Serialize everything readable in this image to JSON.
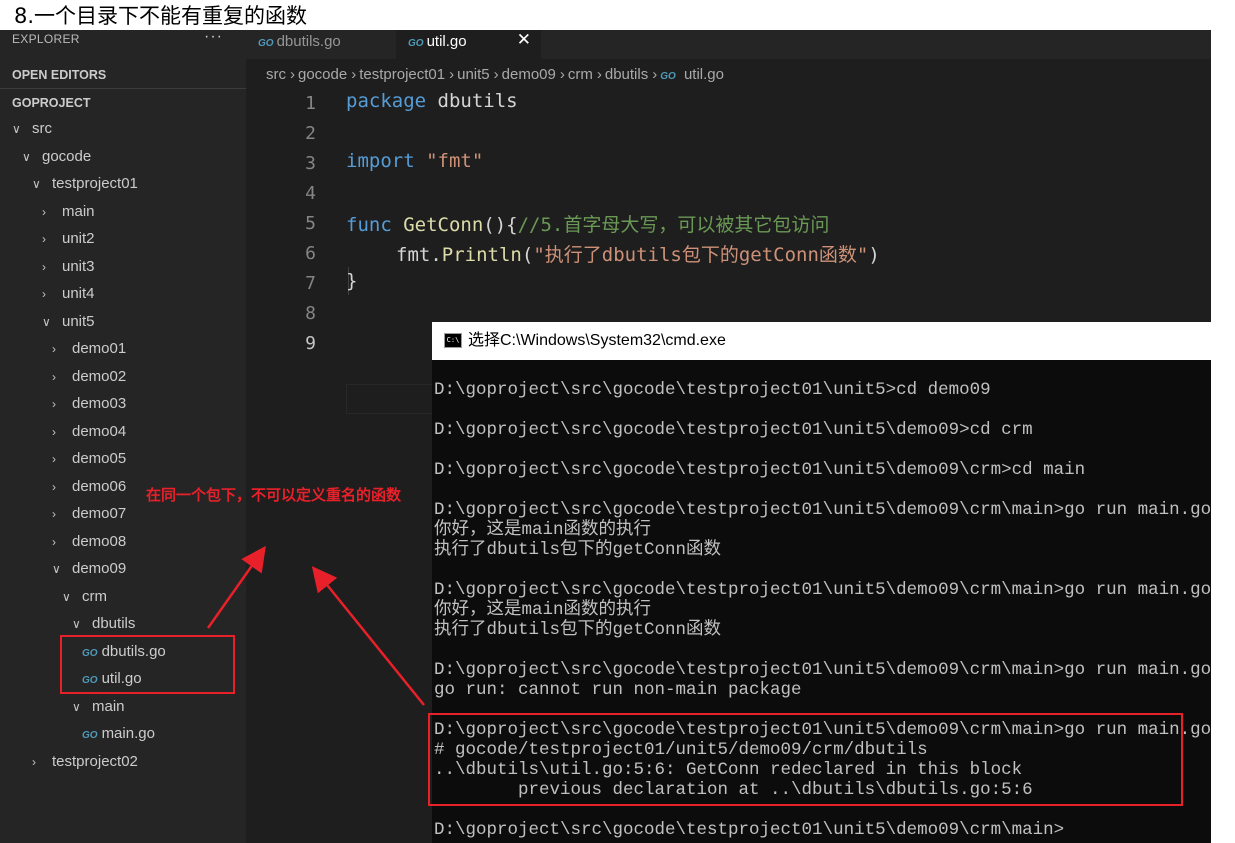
{
  "heading": "8.一个目录下不能有重复的函数",
  "sidebar": {
    "header": "EXPLORER",
    "more": "···",
    "open_editors": "OPEN EDITORS",
    "project": "GOPROJECT",
    "tree": [
      {
        "label": "src",
        "chevron": "∨"
      },
      {
        "label": "gocode",
        "chevron": "∨"
      },
      {
        "label": "testproject01",
        "chevron": "∨"
      },
      {
        "label": "main",
        "chevron": "›"
      },
      {
        "label": "unit2",
        "chevron": "›"
      },
      {
        "label": "unit3",
        "chevron": "›"
      },
      {
        "label": "unit4",
        "chevron": "›"
      },
      {
        "label": "unit5",
        "chevron": "∨"
      },
      {
        "label": "demo01",
        "chevron": "›"
      },
      {
        "label": "demo02",
        "chevron": "›"
      },
      {
        "label": "demo03",
        "chevron": "›"
      },
      {
        "label": "demo04",
        "chevron": "›"
      },
      {
        "label": "demo05",
        "chevron": "›"
      },
      {
        "label": "demo06",
        "chevron": "›"
      },
      {
        "label": "demo07",
        "chevron": "›"
      },
      {
        "label": "demo08",
        "chevron": "›"
      },
      {
        "label": "demo09",
        "chevron": "∨"
      },
      {
        "label": "crm",
        "chevron": "∨"
      },
      {
        "label": "dbutils",
        "chevron": "∨"
      },
      {
        "label": "dbutils.go",
        "icon": "go-file-icon"
      },
      {
        "label": "util.go",
        "icon": "go-file-icon"
      },
      {
        "label": "main",
        "chevron": "∨"
      },
      {
        "label": "main.go",
        "icon": "go-file-icon"
      },
      {
        "label": "testproject02",
        "chevron": "›"
      }
    ]
  },
  "tabs": [
    {
      "label": "dbutils.go",
      "icon": "GO"
    },
    {
      "label": "util.go",
      "icon": "GO",
      "close": "✕"
    }
  ],
  "breadcrumb": [
    "src",
    "gocode",
    "testproject01",
    "unit5",
    "demo09",
    "crm",
    "dbutils",
    "util.go"
  ],
  "breadcrumb_sep": "›",
  "go_icon": "GO",
  "editor": {
    "line_numbers": [
      "1",
      "2",
      "3",
      "4",
      "5",
      "6",
      "7",
      "8",
      "9"
    ],
    "code": {
      "l1_kw": "package",
      "l1_name": " dbutils",
      "l3_kw": "import",
      "l3_str": " \"fmt\"",
      "l5_kw": "func",
      "l5_fn": " GetConn",
      "l5_punc": "(){",
      "l5_cm": "//5.首字母大写，可以被其它包访问",
      "l6_pkg": "fmt",
      "l6_dot": ".",
      "l6_fn": "Println",
      "l6_open": "(",
      "l6_str": "\"执行了dbutils包下的getConn函数\"",
      "l6_close": ")",
      "l7": "}"
    }
  },
  "cmd": {
    "title": "选择C:\\Windows\\System32\\cmd.exe",
    "icon_text": "C:\\",
    "output": "D:\\goproject\\src\\gocode\\testproject01\\unit5>cd demo09\n\nD:\\goproject\\src\\gocode\\testproject01\\unit5\\demo09>cd crm\n\nD:\\goproject\\src\\gocode\\testproject01\\unit5\\demo09\\crm>cd main\n\nD:\\goproject\\src\\gocode\\testproject01\\unit5\\demo09\\crm\\main>go run main.go\n你好，这是main函数的执行\n执行了dbutils包下的getConn函数\n\nD:\\goproject\\src\\gocode\\testproject01\\unit5\\demo09\\crm\\main>go run main.go\n你好，这是main函数的执行\n执行了dbutils包下的getConn函数\n\nD:\\goproject\\src\\gocode\\testproject01\\unit5\\demo09\\crm\\main>go run main.go\ngo run: cannot run non-main package\n\nD:\\goproject\\src\\gocode\\testproject01\\unit5\\demo09\\crm\\main>go run main.go\n# gocode/testproject01/unit5/demo09/crm/dbutils\n..\\dbutils\\util.go:5:6: GetConn redeclared in this block\n        previous declaration at ..\\dbutils\\dbutils.go:5:6\n\nD:\\goproject\\src\\gocode\\testproject01\\unit5\\demo09\\crm\\main>"
  },
  "annotation": "在同一个包下，不可以定义重名的函数",
  "colors": {
    "annotation_red": "#e8202a",
    "keyword": "#569cd6",
    "string": "#ce9178",
    "function": "#dcdcaa",
    "comment": "#6a9955"
  }
}
